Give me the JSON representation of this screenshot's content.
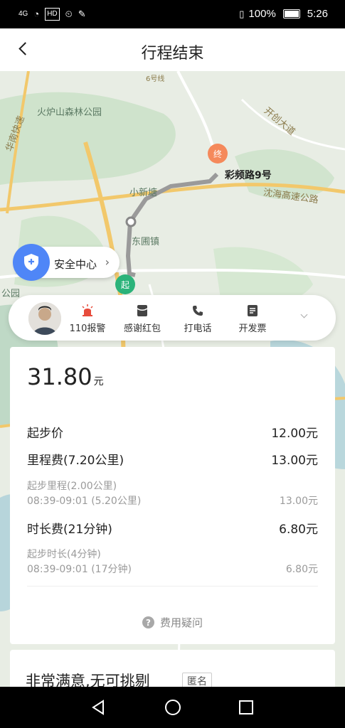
{
  "status_bar": {
    "signal": "4G",
    "time": "5:26",
    "battery": "100%",
    "hd": "HD"
  },
  "header": {
    "title": "行程结束"
  },
  "map": {
    "labels": {
      "park": "火炉山森林公园",
      "kaichuang": "开创大道",
      "huanan": "华南快速",
      "xiaoxintang": "小新塘",
      "donghuzhen": "东圃镇",
      "shenhai": "沈海高速公路",
      "gongyuan": "公园",
      "line6": "6号线",
      "destination": "彩频路9号"
    },
    "pins": {
      "end": "终",
      "start": "起"
    }
  },
  "safety_center": {
    "label": "安全中心"
  },
  "actions": [
    {
      "label": "110报警",
      "icon": "alarm-icon"
    },
    {
      "label": "感谢红包",
      "icon": "red-envelope-icon"
    },
    {
      "label": "打电话",
      "icon": "phone-icon"
    },
    {
      "label": "开发票",
      "icon": "invoice-icon"
    }
  ],
  "fare": {
    "amount": "31.80",
    "unit": "元",
    "items": [
      {
        "label": "起步价",
        "value": "12.00元"
      },
      {
        "label": "里程费(7.20公里)",
        "value": "13.00元"
      },
      {
        "label": "时长费(21分钟)",
        "value": "6.80元"
      }
    ],
    "details": [
      {
        "line1": "起步里程(2.00公里)",
        "line2": "08:39-09:01 (5.20公里)",
        "value": "13.00元"
      },
      {
        "line1": "起步时长(4分钟)",
        "line2": "08:39-09:01 (17分钟)",
        "value": "6.80元"
      }
    ],
    "question": "费用疑问",
    "question_icon": "?"
  },
  "review": {
    "text": "非常满意,无可挑剔",
    "tag": "匿名"
  },
  "colors": {
    "accent": "#4f86f7",
    "start_pin": "#2bb37a",
    "end_pin": "#f5895b",
    "alarm": "#e74c3c"
  }
}
